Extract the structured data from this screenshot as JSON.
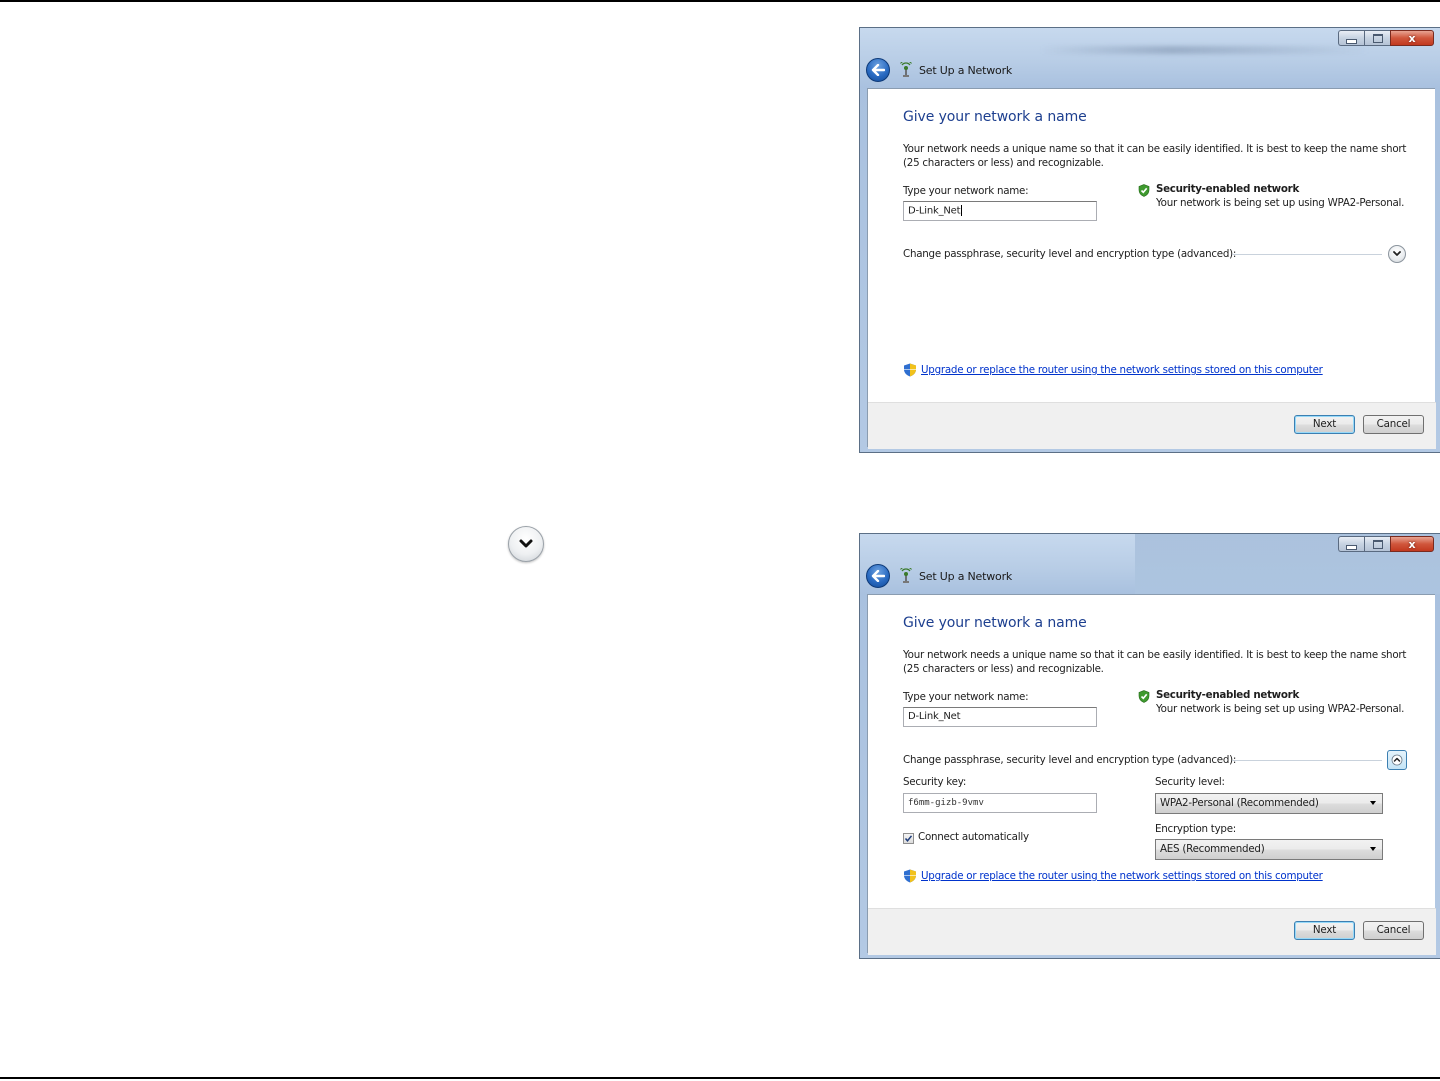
{
  "window_title": "Set Up a Network",
  "heading": "Give your network a name",
  "description": "Your network needs a unique name so that it can be easily identified. It is best to keep the name short (25 characters or less) and recognizable.",
  "name_label": "Type your network name:",
  "name_value": "D-Link_Net",
  "security_title": "Security-enabled network",
  "security_sub": "Your network is being set up using WPA2-Personal.",
  "advanced_label": "Change passphrase, security level and encryption type (advanced):",
  "security_key_label": "Security key:",
  "security_key_value": "f6mm-gizb-9vmv",
  "connect_label": "Connect automatically",
  "security_level_label": "Security level:",
  "security_level_value": "WPA2-Personal (Recommended)",
  "encryption_label": "Encryption type:",
  "encryption_value": "AES (Recommended)",
  "router_link": "Upgrade or replace the router using the network settings stored on this computer",
  "next_label": "Next",
  "cancel_label": "Cancel",
  "icons": [
    "back-arrow-icon",
    "network-icon",
    "shield-check-icon",
    "chevron-down-icon",
    "chevron-up-icon",
    "uac-shield-icon",
    "dropdown-arrow-icon",
    "checkmark-icon"
  ],
  "colors": {
    "heading": "#1d3f8f",
    "link": "#0033cc",
    "close_button": "#c2391f"
  }
}
